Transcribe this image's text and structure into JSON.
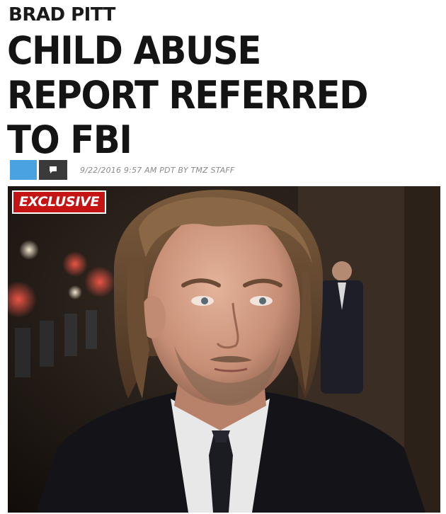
{
  "article": {
    "kicker": "BRAD PITT",
    "headline": "CHILD ABUSE REPORT REFERRED TO FBI",
    "byline": "9/22/2016 9:57 AM PDT BY TMZ STAFF",
    "badge": "EXCLUSIVE"
  },
  "icons": {
    "share": "share-button",
    "comment": "comment-icon"
  },
  "colors": {
    "share_blue": "#4aa3e0",
    "comment_dark": "#3a3a3a",
    "badge_red": "#c41414"
  }
}
